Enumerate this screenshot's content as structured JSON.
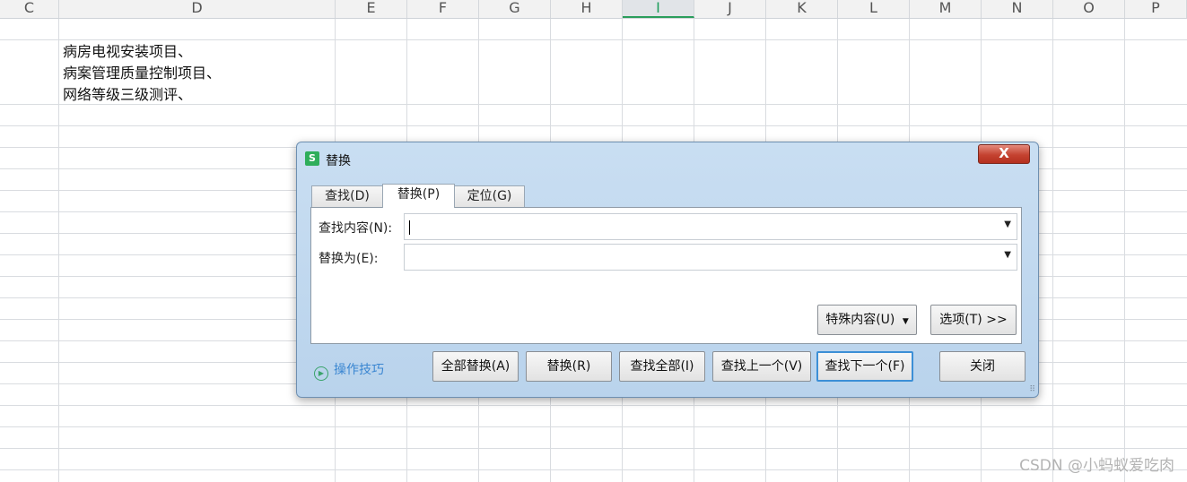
{
  "sheet": {
    "columns": [
      "C",
      "D",
      "E",
      "F",
      "G",
      "H",
      "I",
      "J",
      "K",
      "L",
      "M",
      "N",
      "O",
      "P"
    ],
    "selected_column": "I",
    "cell_lines": [
      "病房电视安装项目、",
      "病案管理质量控制项目、",
      "网络等级三级测评、"
    ]
  },
  "dialog": {
    "title": "替换",
    "app_icon": "S",
    "close_label": "X",
    "tabs": [
      {
        "label": "查找(D)",
        "active": false
      },
      {
        "label": "替换(P)",
        "active": true
      },
      {
        "label": "定位(G)",
        "active": false
      }
    ],
    "find_label": "查找内容(N):",
    "find_value": "",
    "replace_label": "替换为(E):",
    "replace_value": "",
    "special_button": "特殊内容(U)",
    "options_button": "选项(T) >>",
    "tips_label": "操作技巧",
    "buttons": {
      "replace_all": "全部替换(A)",
      "replace": "替换(R)",
      "find_all": "查找全部(I)",
      "find_prev": "查找上一个(V)",
      "find_next": "查找下一个(F)",
      "close": "关闭"
    }
  },
  "watermark": "CSDN @小蚂蚁爱吃肉",
  "colors": {
    "accent": "#2a9d5c",
    "dialog_bg": "#c9def2",
    "link": "#3a86d1"
  }
}
